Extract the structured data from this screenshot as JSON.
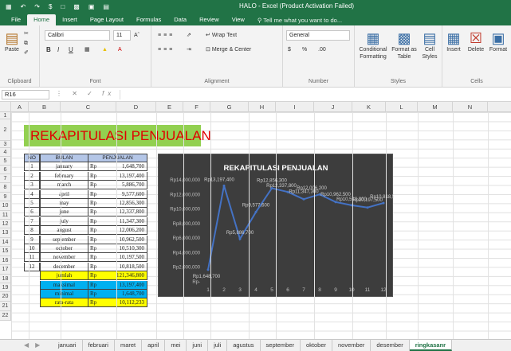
{
  "window": {
    "title": "HALO - Excel (Product Activation Failed)"
  },
  "menu": {
    "tabs": [
      "File",
      "Home",
      "Insert",
      "Page Layout",
      "Formulas",
      "Data",
      "Review",
      "View"
    ],
    "tell_me": "Tell me what you want to do..."
  },
  "ribbon": {
    "clipboard": {
      "paste": "Paste",
      "label": "Clipboard"
    },
    "font": {
      "name": "Calibri",
      "size": "11",
      "label": "Font",
      "bold": "B",
      "italic": "I",
      "underline": "U"
    },
    "alignment": {
      "wrap": "Wrap Text",
      "merge": "Merge & Center",
      "label": "Alignment"
    },
    "number": {
      "format": "General",
      "currency": "$",
      "percent": "%",
      "label": "Number"
    },
    "styles": {
      "conditional": "Conditional Formatting",
      "format_table": "Format as Table",
      "cell_styles": "Cell Styles",
      "label": "Styles"
    },
    "cells": {
      "insert": "Insert",
      "delete": "Delete",
      "format": "Format",
      "label": "Cells"
    }
  },
  "formula_bar": {
    "name_box": "R16",
    "fx": "fx",
    "value": ""
  },
  "columns": [
    "A",
    "B",
    "C",
    "D",
    "E",
    "F",
    "G",
    "H",
    "I",
    "J",
    "K",
    "L",
    "M",
    "N"
  ],
  "rows": [
    "1",
    "2",
    "3",
    "4",
    "5",
    "6",
    "7",
    "8",
    "9",
    "10",
    "11",
    "12",
    "13",
    "14",
    "15",
    "16",
    "17",
    "18",
    "19",
    "20",
    "21",
    "22"
  ],
  "sheet_title": "REKAPITULASI PENJUALAN",
  "table": {
    "headers": {
      "no": "NO",
      "bulan": "BULAN",
      "penjualan": "PENJUALAN"
    },
    "rows": [
      {
        "no": "1",
        "bulan": "january",
        "cur": "Rp",
        "val": "1,648,700"
      },
      {
        "no": "2",
        "bulan": "february",
        "cur": "Rp",
        "val": "13,197,400"
      },
      {
        "no": "3",
        "bulan": "march",
        "cur": "Rp",
        "val": "5,886,700"
      },
      {
        "no": "4",
        "bulan": "april",
        "cur": "Rp",
        "val": "9,577,600"
      },
      {
        "no": "5",
        "bulan": "may",
        "cur": "Rp",
        "val": "12,856,300"
      },
      {
        "no": "6",
        "bulan": "june",
        "cur": "Rp",
        "val": "12,337,800"
      },
      {
        "no": "7",
        "bulan": "july",
        "cur": "Rp",
        "val": "11,347,300"
      },
      {
        "no": "8",
        "bulan": "august",
        "cur": "Rp",
        "val": "12,006,200"
      },
      {
        "no": "9",
        "bulan": "september",
        "cur": "Rp",
        "val": "10,962,500"
      },
      {
        "no": "10",
        "bulan": "october",
        "cur": "Rp",
        "val": "10,510,300"
      },
      {
        "no": "11",
        "bulan": "november",
        "cur": "Rp",
        "val": "10,197,500"
      },
      {
        "no": "12",
        "bulan": "december",
        "cur": "Rp",
        "val": "10,818,500"
      }
    ],
    "summary": [
      {
        "label": "jumlah",
        "cur": "Rp",
        "val": "121,346,800",
        "color": "#ffff00"
      },
      {
        "label": "maksimal",
        "cur": "Rp",
        "val": "13,197,400",
        "color": "#00b0f0"
      },
      {
        "label": "minimal",
        "cur": "Rp",
        "val": "1,648,700",
        "color": "#00b0f0"
      },
      {
        "label": "rata-rata",
        "cur": "Rp",
        "val": "10,112,233",
        "color": "#ffff00"
      }
    ]
  },
  "chart_data": {
    "type": "line",
    "title": "REKAPITULASI PENJUALAN",
    "categories": [
      "1",
      "2",
      "3",
      "4",
      "5",
      "6",
      "7",
      "8",
      "9",
      "10",
      "11",
      "12"
    ],
    "values": [
      1648700,
      13197400,
      5886700,
      9577600,
      12856300,
      12337800,
      11347300,
      12006200,
      10962500,
      10510300,
      10197500,
      10818500
    ],
    "data_labels": [
      "Rp1,648,700",
      "Rp13,197,400",
      "Rp5,886,700",
      "Rp9,577,600",
      "Rp12,856,300",
      "Rp12,337,800",
      "Rp11,347,300",
      "Rp12,006,200",
      "Rp10,962,500",
      "Rp10,510,300",
      "Rp10,197,500",
      "Rp10,818,500"
    ],
    "ytick_labels": [
      "Rp-",
      "Rp2,000,000",
      "Rp4,000,000",
      "Rp6,000,000",
      "Rp8,000,000",
      "Rp10,000,000",
      "Rp12,000,000",
      "Rp14,000,000"
    ],
    "ylim": [
      0,
      14000000
    ],
    "line_color": "#4472c4",
    "background": "#3d3d3d"
  },
  "sheet_tabs": [
    "januari",
    "februari",
    "maret",
    "april",
    "mei",
    "juni",
    "juli",
    "agustus",
    "september",
    "oktober",
    "november",
    "desember",
    "ringkasanr"
  ],
  "active_sheet": "ringkasanr"
}
